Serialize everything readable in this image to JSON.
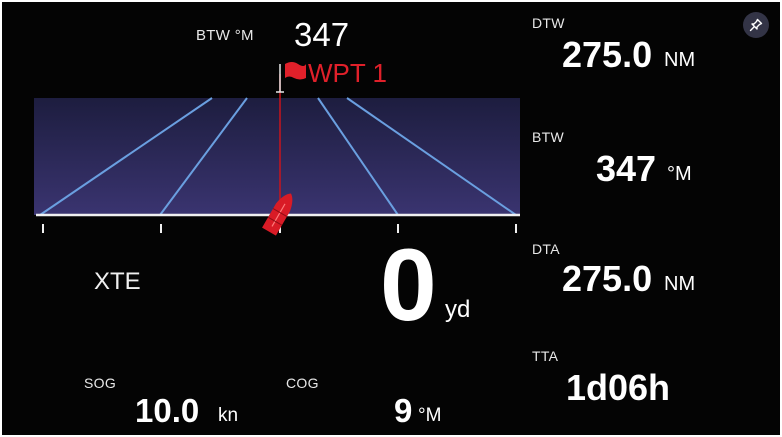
{
  "header": {
    "btw_label": "BTW °M",
    "btw_value": "347",
    "waypoint_name": "WPT 1"
  },
  "xte": {
    "label": "XTE",
    "value": "0",
    "unit": "yd",
    "offset": 0
  },
  "bottom": {
    "sog_label": "SOG",
    "sog_value": "10.0",
    "sog_unit": "kn",
    "cog_label": "COG",
    "cog_value": "9",
    "cog_unit": "°M"
  },
  "sidebar": {
    "dtw_label": "DTW",
    "dtw_value": "275.0",
    "dtw_unit": "NM",
    "btw_label": "BTW",
    "btw_value": "347",
    "btw_unit": "°M",
    "dta_label": "DTA",
    "dta_value": "275.0",
    "dta_unit": "NM",
    "tta_label": "TTA",
    "tta_value": "1d06h"
  },
  "icons": {
    "pin": "pin-icon",
    "flag": "flag-icon",
    "boat": "boat-icon"
  },
  "colors": {
    "background": "#040404",
    "waypoint": "#e0202a",
    "vessel": "#d91b26",
    "highway_top": "#1b1b3e",
    "highway_bottom": "#3a3470",
    "lane_line": "#6a9fe0"
  }
}
